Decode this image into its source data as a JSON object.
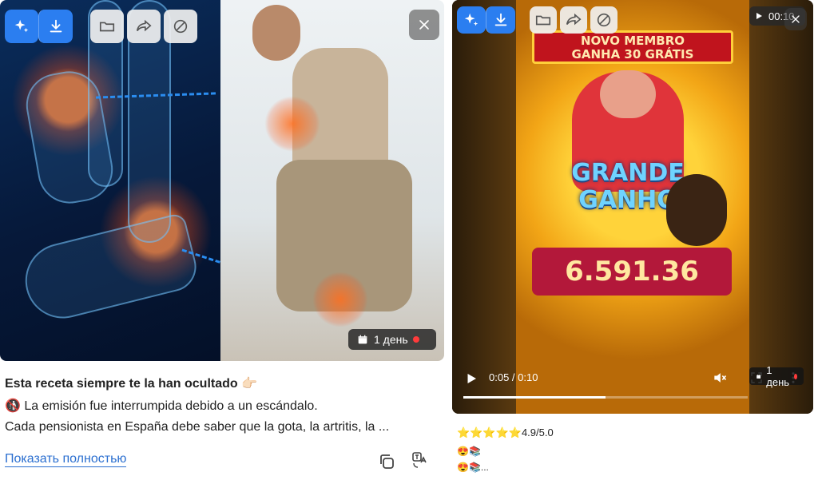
{
  "left_post": {
    "date_badge": "1 день",
    "title": "Esta receta siempre te la han ocultado 👉🏻",
    "line2": "🚯 La emisión fue interrumpida debido a un escándalo.",
    "line3": "Cada pensionista en España debe saber que la gota, la artritis, la ...",
    "expand_link": "Показать полностью"
  },
  "right_post": {
    "promo_banner_line1": "NOVO MEMBRO",
    "promo_banner_line2": "GANHA 30 GRÁTIS",
    "grande_line1": "GRANDE",
    "grande_line2": "GANHO",
    "amount": "6.591.36",
    "top_time": "00:10",
    "player_time": "0:05 / 0:10",
    "progress_fraction": 0.5,
    "date_badge": "1 день",
    "rating_stars": "⭐⭐⭐⭐⭐",
    "rating_value": "4.9/5.0",
    "emoji_line1": "😍📚",
    "emoji_line2": "😍📚..."
  },
  "colors": {
    "accent_blue": "#2b7ef0",
    "link_blue": "#2b6fd0",
    "live_dot": "#ff3b3b"
  },
  "icons": [
    "sparkle-icon",
    "download-icon",
    "folder-icon",
    "share-icon",
    "block-icon",
    "close-icon",
    "calendar-icon",
    "copy-icon",
    "translate-icon",
    "play-icon",
    "volume-muted-icon",
    "fullscreen-icon",
    "more-icon"
  ]
}
